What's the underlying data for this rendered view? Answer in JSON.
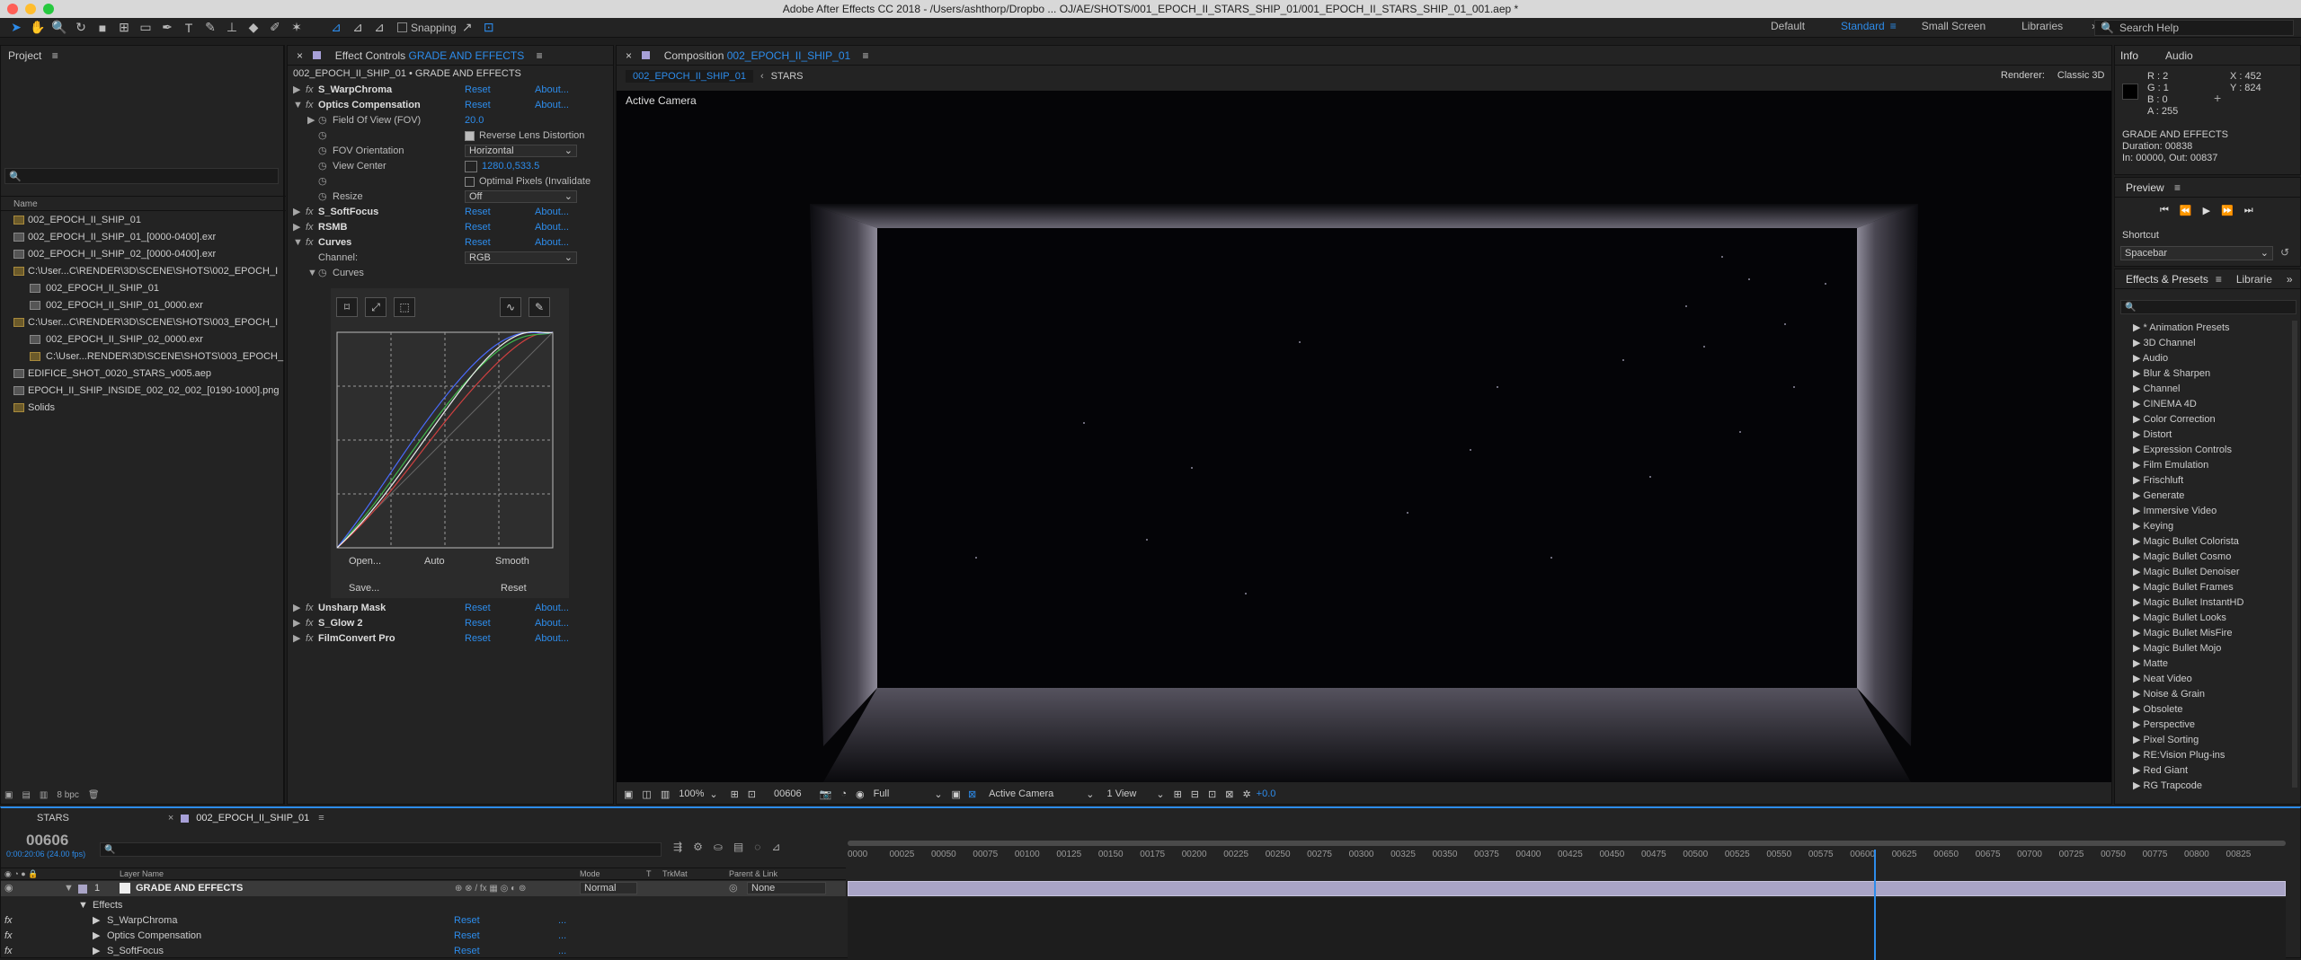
{
  "window": {
    "title": "Adobe After Effects CC 2018 - /Users/ashthorp/Dropbo ... OJ/AE/SHOTS/001_EPOCH_II_STARS_SHIP_01/001_EPOCH_II_STARS_SHIP_01_001.aep *"
  },
  "toolbar": {
    "snapping_label": "Snapping",
    "workspaces": [
      "Default",
      "Standard",
      "Small Screen",
      "Libraries"
    ],
    "active_workspace": "Standard",
    "search_placeholder": "Search Help"
  },
  "project": {
    "title": "Project",
    "column_name": "Name",
    "items": [
      "002_EPOCH_II_SHIP_01",
      "002_EPOCH_II_SHIP_01_[0000-0400].exr",
      "002_EPOCH_II_SHIP_02_[0000-0400].exr",
      "C:\\User...C\\RENDER\\3D\\SCENE\\SHOTS\\002_EPOCH_I",
      "002_EPOCH_II_SHIP_01",
      "002_EPOCH_II_SHIP_01_0000.exr",
      "C:\\User...C\\RENDER\\3D\\SCENE\\SHOTS\\003_EPOCH_I",
      "002_EPOCH_II_SHIP_02_0000.exr",
      "C:\\User...RENDER\\3D\\SCENE\\SHOTS\\003_EPOCH_",
      "EDIFICE_SHOT_0020_STARS_v005.aep",
      "EPOCH_II_SHIP_INSIDE_002_02_002_[0190-1000].png",
      "Solids"
    ],
    "bpc": "8 bpc"
  },
  "effect_controls": {
    "tab_label": "Effect Controls",
    "tab_target": "GRADE AND EFFECTS",
    "breadcrumb": "002_EPOCH_II_SHIP_01 • GRADE AND EFFECTS",
    "reset": "Reset",
    "about": "About...",
    "effects_top": [
      "S_WarpChroma",
      "Optics Compensation"
    ],
    "fov_label": "Field Of View (FOV)",
    "fov_value": "20.0",
    "reverse_label": "Reverse Lens Distortion",
    "fov_orient_label": "FOV Orientation",
    "fov_orient_value": "Horizontal",
    "view_center_label": "View Center",
    "view_center_value": "1280.0,533.5",
    "optimal_label": "Optimal Pixels (Invalidate",
    "resize_label": "Resize",
    "resize_value": "Off",
    "effects_mid": [
      "S_SoftFocus",
      "RSMB",
      "Curves"
    ],
    "channel_label": "Channel:",
    "channel_value": "RGB",
    "curves_label": "Curves",
    "curve_buttons": [
      "Open...",
      "Auto",
      "Smooth",
      "Save...",
      "Reset"
    ],
    "effects_bottom": [
      "Unsharp Mask",
      "S_Glow 2",
      "FilmConvert Pro"
    ]
  },
  "composition": {
    "tab_label": "Composition",
    "tab_name": "002_EPOCH_II_SHIP_01",
    "crumbs": [
      "002_EPOCH_II_SHIP_01",
      "STARS"
    ],
    "renderer_label": "Renderer:",
    "renderer_value": "Classic 3D",
    "camera_label": "Active Camera",
    "footer": {
      "zoom": "100%",
      "frame": "00606",
      "res": "Full",
      "camera": "Active Camera",
      "view": "1 View",
      "exposure": "+0.0"
    }
  },
  "info": {
    "tabs": [
      "Info",
      "Audio"
    ],
    "r": "R : 2",
    "g": "G : 1",
    "b": "B : 0",
    "a": "A : 255",
    "x": "X : 452",
    "y": "Y : 824",
    "layer_name": "GRADE AND EFFECTS",
    "duration": "Duration: 00838",
    "inout": "In: 00000, Out: 00837"
  },
  "preview": {
    "title": "Preview",
    "shortcut_label": "Shortcut",
    "shortcut_value": "Spacebar"
  },
  "effects_presets": {
    "tabs": [
      "Effects & Presets",
      "Librarie"
    ],
    "items": [
      "* Animation Presets",
      "3D Channel",
      "Audio",
      "Blur & Sharpen",
      "Channel",
      "CINEMA 4D",
      "Color Correction",
      "Distort",
      "Expression Controls",
      "Film Emulation",
      "Frischluft",
      "Generate",
      "Immersive Video",
      "Keying",
      "Magic Bullet Colorista",
      "Magic Bullet Cosmo",
      "Magic Bullet Denoiser",
      "Magic Bullet Frames",
      "Magic Bullet InstantHD",
      "Magic Bullet Looks",
      "Magic Bullet MisFire",
      "Magic Bullet Mojo",
      "Matte",
      "Neat Video",
      "Noise & Grain",
      "Obsolete",
      "Perspective",
      "Pixel Sorting",
      "RE:Vision Plug-ins",
      "Red Giant",
      "RG Trapcode"
    ]
  },
  "timeline": {
    "tabs": [
      "STARS",
      "002_EPOCH_II_SHIP_01"
    ],
    "timecode": "00606",
    "fps": "0:00:20:06 (24.00 fps)",
    "col_layer_name": "Layer Name",
    "col_mode": "Mode",
    "col_t": "T",
    "col_trkmat": "TrkMat",
    "col_parent": "Parent & Link",
    "layer_num": "1",
    "layer_name": "GRADE AND EFFECTS",
    "layer_mode": "Normal",
    "layer_parent": "None",
    "effects_label": "Effects",
    "sub_effects": [
      "S_WarpChroma",
      "Optics Compensation",
      "S_SoftFocus"
    ],
    "reset": "Reset",
    "dots": "...",
    "ticks": [
      "0000",
      "00025",
      "00050",
      "00075",
      "00100",
      "00125",
      "00150",
      "00175",
      "00200",
      "00225",
      "00250",
      "00275",
      "00300",
      "00325",
      "00350",
      "00375",
      "00400",
      "00425",
      "00450",
      "00475",
      "00500",
      "00525",
      "00550",
      "00575",
      "00600",
      "00625",
      "00650",
      "00675",
      "00700",
      "00725",
      "00750",
      "00775",
      "00800",
      "00825"
    ],
    "playhead_fraction": 0.723
  },
  "colors": {
    "accent": "#2d8ceb",
    "layer_bar": "#a9a4c6"
  }
}
